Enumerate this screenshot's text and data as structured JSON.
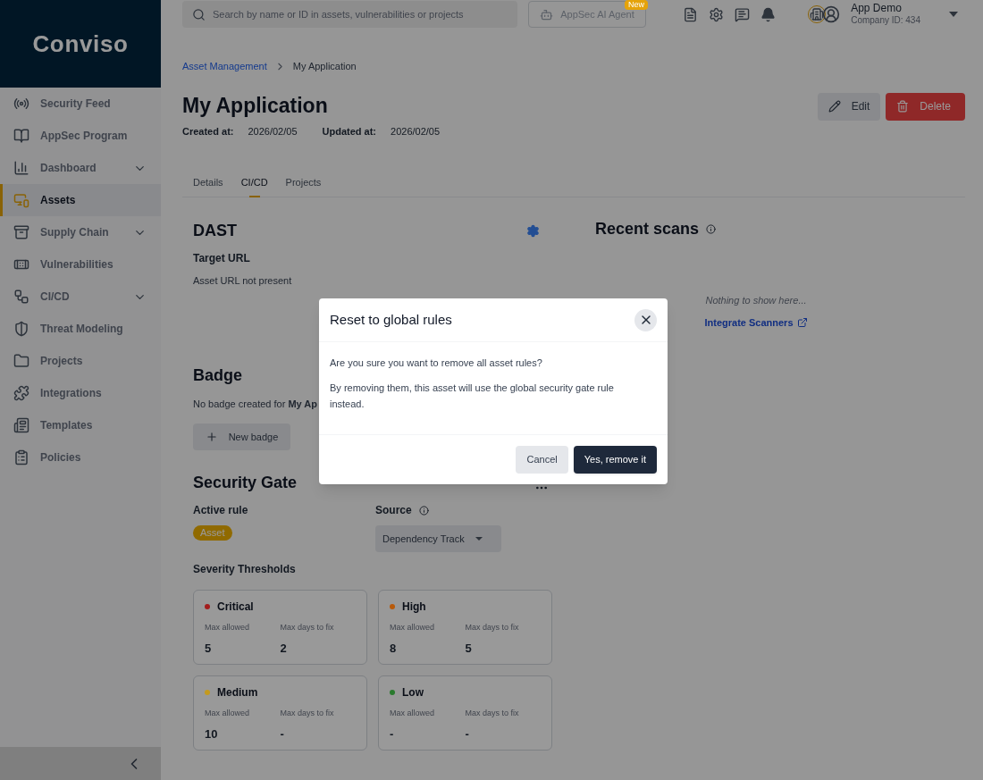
{
  "logo": "Conviso",
  "nav": [
    {
      "label": "Security Feed",
      "selected": false,
      "expandable": false
    },
    {
      "label": "AppSec Program",
      "selected": false,
      "expandable": false
    },
    {
      "label": "Dashboard",
      "selected": false,
      "expandable": true
    },
    {
      "label": "Assets",
      "selected": true,
      "expandable": false
    },
    {
      "label": "Supply Chain",
      "selected": false,
      "expandable": true
    },
    {
      "label": "Vulnerabilities",
      "selected": false,
      "expandable": false
    },
    {
      "label": "CI/CD",
      "selected": false,
      "expandable": true
    },
    {
      "label": "Threat Modeling",
      "selected": false,
      "expandable": false
    },
    {
      "label": "Projects",
      "selected": false,
      "expandable": false
    },
    {
      "label": "Integrations",
      "selected": false,
      "expandable": false
    },
    {
      "label": "Templates",
      "selected": false,
      "expandable": false
    },
    {
      "label": "Policies",
      "selected": false,
      "expandable": false
    }
  ],
  "topbar": {
    "search_placeholder": "Search by name or ID in assets, vulnerabilities or projects",
    "ai_agent": {
      "label": "AppSec AI Agent",
      "badge": "New"
    },
    "user": {
      "name": "App Demo",
      "company": "Company ID: 434"
    }
  },
  "breadcrumb": [
    {
      "label": "Asset Management",
      "link": true
    },
    {
      "label": "My Application",
      "link": false
    }
  ],
  "title": "My Application",
  "meta": [
    {
      "label": "Created at:",
      "value": "2026/02/05"
    },
    {
      "label": "Updated at:",
      "value": "2026/02/05"
    }
  ],
  "actions": [
    {
      "kind": "edit",
      "label": "Edit"
    },
    {
      "kind": "delete",
      "label": "Delete"
    }
  ],
  "tabs": [
    {
      "label": "Details",
      "selected": false
    },
    {
      "label": "CI/CD",
      "selected": true
    },
    {
      "label": "Projects",
      "selected": false
    }
  ],
  "dast": {
    "title": "DAST",
    "field_label": "Target URL",
    "value": "Asset URL not present"
  },
  "badge": {
    "title": "Badge",
    "text": "No badge created for **My Ap**",
    "button": "New badge"
  },
  "security_gate": {
    "title": "Security Gate",
    "active_rule_label": "Active rule",
    "active_rule": "Asset",
    "source_label": "Source",
    "source_value": "Dependency Track",
    "thresholds_label": "Severity Thresholds",
    "thresholds": [
      {
        "name": "Critical",
        "color": "#a31d1d",
        "max_allowed_label": "Max allowed",
        "max_allowed": "5",
        "max_days_label": "Max days to fix",
        "max_days": "2"
      },
      {
        "name": "High",
        "color": "#b85a0a",
        "max_allowed_label": "Max allowed",
        "max_allowed": "8",
        "max_days_label": "Max days to fix",
        "max_days": "5"
      },
      {
        "name": "Medium",
        "color": "#c49a1e",
        "max_allowed_label": "Max allowed",
        "max_allowed": "10",
        "max_days_label": "Max days to fix",
        "max_days": "-"
      },
      {
        "name": "Low",
        "color": "#2a7a2e",
        "max_allowed_label": "Max allowed",
        "max_allowed": "-",
        "max_days_label": "Max days to fix",
        "max_days": "-"
      }
    ]
  },
  "recent_scans": {
    "title": "Recent scans",
    "empty": "Nothing to show here...",
    "link": "Integrate Scanners"
  },
  "modal": {
    "title": "Reset to global rules",
    "paragraphs": [
      "Are you sure you want to remove all asset rules?",
      "By removing them, this asset will use the global security gate rule instead."
    ],
    "buttons": [
      {
        "kind": "secondary",
        "label": "Cancel"
      },
      {
        "kind": "primary",
        "label": "Yes, remove it"
      }
    ]
  }
}
